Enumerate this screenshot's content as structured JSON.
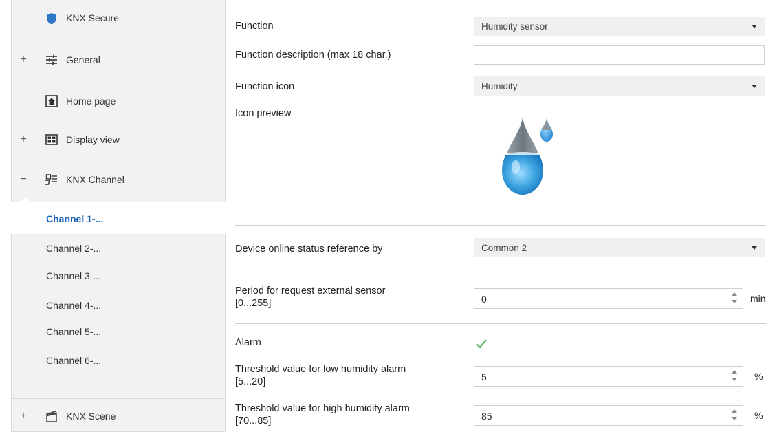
{
  "sidebar": {
    "items": [
      {
        "expander": "",
        "icon": "shield-icon",
        "label": "KNX Secure"
      },
      {
        "expander": "+",
        "icon": "sliders-icon",
        "label": "General"
      },
      {
        "expander": "",
        "icon": "home-icon",
        "label": "Home page"
      },
      {
        "expander": "+",
        "icon": "grid-icon",
        "label": "Display view"
      },
      {
        "expander": "−",
        "icon": "channel-icon",
        "label": "KNX Channel"
      }
    ],
    "channels": [
      "Channel 1-...",
      "Channel 2-...",
      "Channel 3-...",
      "Channel 4-...",
      "Channel 5-...",
      "Channel 6-..."
    ],
    "active_channel": "Channel 1-...",
    "scene": {
      "expander": "+",
      "icon": "scene-icon",
      "label": "KNX Scene"
    }
  },
  "main": {
    "function": {
      "label": "Function",
      "value": "Humidity sensor"
    },
    "function_description": {
      "label": "Function description (max 18 char.)",
      "value": ""
    },
    "function_icon": {
      "label": "Function icon",
      "value": "Humidity"
    },
    "icon_preview": {
      "label": "Icon preview",
      "icon": "humidity-drops-icon"
    },
    "device_online": {
      "label": "Device online status reference by",
      "value": "Common 2"
    },
    "period": {
      "label_line1": "Period for request external sensor",
      "label_line2": "[0...255]",
      "value": "0",
      "unit": "min"
    },
    "alarm": {
      "label": "Alarm",
      "checked": true
    },
    "low_threshold": {
      "label_line1": "Threshold value for low humidity alarm",
      "label_line2": "[5...20]",
      "value": "5",
      "unit": "%"
    },
    "high_threshold": {
      "label_line1": "Threshold value for high humidity alarm",
      "label_line2": "[70...85]",
      "value": "85",
      "unit": "%"
    }
  },
  "colors": {
    "accent": "#1c63b7",
    "check": "#4caf50",
    "drop": "#3ba3e0"
  }
}
